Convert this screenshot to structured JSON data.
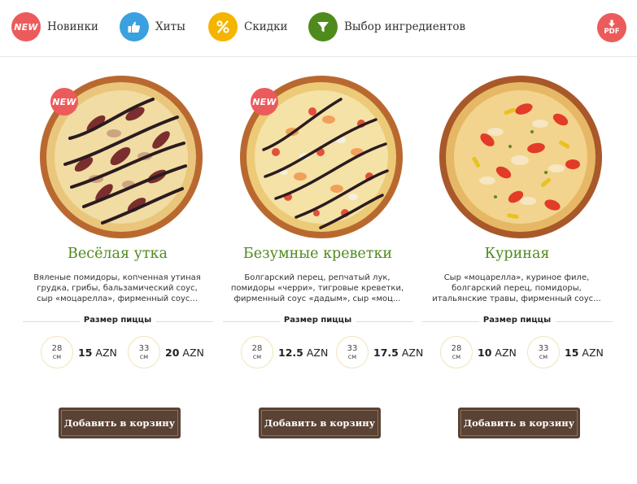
{
  "nav": {
    "new_badge": "NEW",
    "items": [
      {
        "label": "Новинки",
        "color": "#ec5b5b"
      },
      {
        "label": "Хиты",
        "color": "#3aa0e0"
      },
      {
        "label": "Скидки",
        "color": "#f5b400"
      },
      {
        "label": "Выбор ингредиентов",
        "color": "#4f8a1c"
      }
    ],
    "pdf": {
      "label": "PDF",
      "color": "#ec5b5b"
    }
  },
  "size_label": "Размер пиццы",
  "cart_label": "Добавить в корзину",
  "unit_cm": "см",
  "colors": {
    "accent_green": "#4f8a1c",
    "button_brown": "#5a4234",
    "badge_red": "#ec5b5b"
  },
  "products": [
    {
      "name": "Весёлая утка",
      "is_new": true,
      "badge": "NEW",
      "desc": [
        "Вяленые помидоры, копченная утиная",
        "грудка, грибы, бальзамический соус,",
        "сыр «моцарелла», фирменный соус..."
      ],
      "sizes": [
        {
          "cm": "28",
          "price": "15",
          "cur": "AZN"
        },
        {
          "cm": "33",
          "price": "20",
          "cur": "AZN"
        }
      ]
    },
    {
      "name": "Безумные креветки",
      "is_new": true,
      "badge": "NEW",
      "desc": [
        "Болгарский перец, репчатый лук,",
        "помидоры «черри», тигровые креветки,",
        "фирменный соус «дадым», сыр «моц..."
      ],
      "sizes": [
        {
          "cm": "28",
          "price": "12.5",
          "cur": "AZN"
        },
        {
          "cm": "33",
          "price": "17.5",
          "cur": "AZN"
        }
      ]
    },
    {
      "name": "Куриная",
      "is_new": false,
      "badge": "",
      "desc": [
        "Сыр «моцарелла», куриное филе,",
        "болгарский перец, помидоры,",
        "итальянские травы, фирменный соус..."
      ],
      "sizes": [
        {
          "cm": "28",
          "price": "10",
          "cur": "AZN"
        },
        {
          "cm": "33",
          "price": "15",
          "cur": "AZN"
        }
      ]
    }
  ]
}
